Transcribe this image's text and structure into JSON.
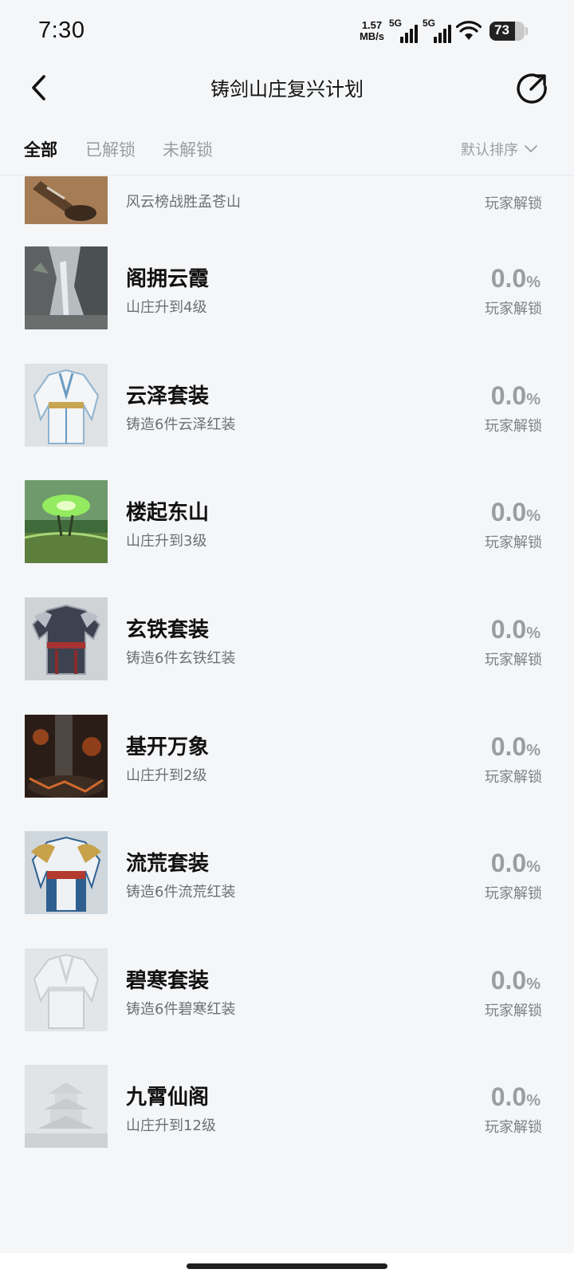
{
  "status_bar": {
    "time": "7:30",
    "net_speed_value": "1.57",
    "net_speed_unit": "MB/s",
    "sim1_type": "5G",
    "sim2_type": "5G",
    "battery_level": "73",
    "battery_fraction": 0.73
  },
  "header": {
    "title": "铸剑山庄复兴计划",
    "back_icon": "chevron-left-icon",
    "share_icon": "share-arrow-icon"
  },
  "tabs": [
    {
      "label": "全部",
      "active": true
    },
    {
      "label": "已解锁",
      "active": false
    },
    {
      "label": "未解锁",
      "active": false
    }
  ],
  "sort": {
    "label": "默认排序",
    "icon": "chevron-down-icon"
  },
  "items": [
    {
      "title": "",
      "desc": "风云榜战胜孟苍山",
      "percent": "",
      "unlock_label": "玩家解锁",
      "image": "warrior-portrait"
    },
    {
      "title": "阁拥云霞",
      "desc": "山庄升到4级",
      "percent": "0.0",
      "unlock_label": "玩家解锁",
      "image": "mountain-cliff"
    },
    {
      "title": "云泽套装",
      "desc": "铸造6件云泽红装",
      "percent": "0.0",
      "unlock_label": "玩家解锁",
      "image": "white-robe-armor"
    },
    {
      "title": "楼起东山",
      "desc": "山庄升到3级",
      "percent": "0.0",
      "unlock_label": "玩家解锁",
      "image": "green-swamp"
    },
    {
      "title": "玄铁套装",
      "desc": "铸造6件玄铁红装",
      "percent": "0.0",
      "unlock_label": "玩家解锁",
      "image": "iron-armor"
    },
    {
      "title": "基开万象",
      "desc": "山庄升到2级",
      "percent": "0.0",
      "unlock_label": "玩家解锁",
      "image": "forge-cave"
    },
    {
      "title": "流荒套装",
      "desc": "铸造6件流荒红装",
      "percent": "0.0",
      "unlock_label": "玩家解锁",
      "image": "gold-blue-armor"
    },
    {
      "title": "碧寒套装",
      "desc": "铸造6件碧寒红装",
      "percent": "0.0",
      "unlock_label": "玩家解锁",
      "image": "faded-robe"
    },
    {
      "title": "九霄仙阁",
      "desc": "山庄升到12级",
      "percent": "0.0",
      "unlock_label": "玩家解锁",
      "image": "faded-pavilion"
    }
  ],
  "percent_symbol": "%"
}
